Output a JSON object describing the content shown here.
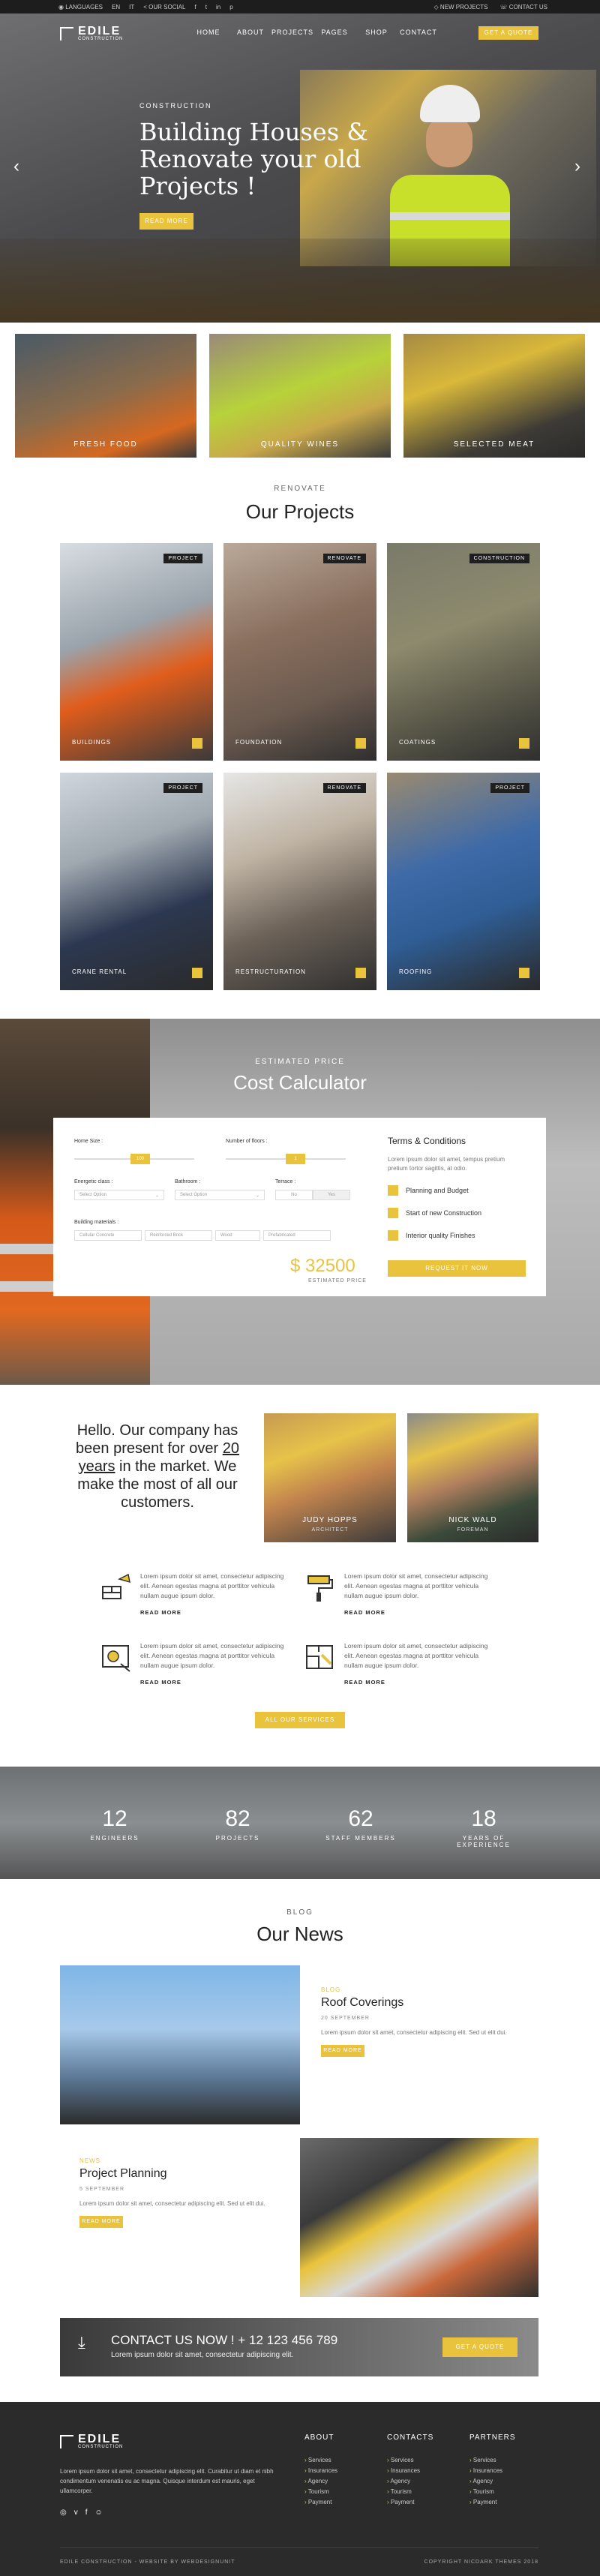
{
  "topbar": {
    "languages": "LANGUAGES",
    "lang_en": "EN",
    "lang_it": "IT",
    "social": "OUR SOCIAL",
    "new_projects": "NEW PROJECTS",
    "contact": "CONTACT US"
  },
  "brand": {
    "name": "EDILE",
    "tagline": "CONSTRUCTION"
  },
  "nav": {
    "items": [
      "HOME",
      "ABOUT",
      "PROJECTS",
      "PAGES",
      "SHOP",
      "CONTACT"
    ],
    "quote": "GET A QUOTE"
  },
  "hero": {
    "eyebrow": "CONSTRUCTION",
    "title": "Building Houses & Renovate your old Projects !",
    "button": "READ MORE"
  },
  "categories": [
    "FRESH FOOD",
    "QUALITY WINES",
    "SELECTED MEAT"
  ],
  "projects_section": {
    "eyebrow": "RENOVATE",
    "title": "Our Projects",
    "items": [
      {
        "tag": "PROJECT",
        "name": "BUILDINGS"
      },
      {
        "tag": "RENOVATE",
        "name": "FOUNDATION"
      },
      {
        "tag": "CONSTRUCTION",
        "name": "COATINGS"
      },
      {
        "tag": "PROJECT",
        "name": "CRANE RENTAL"
      },
      {
        "tag": "RENOVATE",
        "name": "RESTRUCTURATION"
      },
      {
        "tag": "PROJECT",
        "name": "ROOFING"
      }
    ]
  },
  "calculator": {
    "eyebrow": "ESTIMATED PRICE",
    "title": "Cost Calculator",
    "home_size_label": "Home Size :",
    "home_size_value": "100",
    "floors_label": "Number of floors :",
    "floors_value": "1",
    "energy_label": "Energetic class :",
    "energy_value": "Select Option",
    "bathroom_label": "Bathroom :",
    "bathroom_value": "Select Option",
    "terrace_label": "Terrace :",
    "terrace_no": "No",
    "terrace_yes": "Yes",
    "materials_label": "Building materials :",
    "materials": [
      "Cellular Concrete",
      "Reinforced Brick",
      "Wood",
      "Prefabricated"
    ],
    "terms_title": "Terms & Conditions",
    "terms_text": "Lorem ipsum dolor sit amet, tempus pretium pretium tortor sagittis, at odio.",
    "checks": [
      "Planning and Budget",
      "Start of new Construction",
      "Interior quality Finishes"
    ],
    "price": "$ 32500",
    "price_label": "ESTIMATED PRICE",
    "request": "REQUEST IT NOW"
  },
  "about": {
    "pre": "Hello. Our company has been present for over ",
    "years": "20 years",
    "post": " in the market. We make the most of all our customers.",
    "people": [
      {
        "name": "JUDY HOPPS",
        "role": "ARCHITECT"
      },
      {
        "name": "NICK WALD",
        "role": "FOREMAN"
      }
    ],
    "services_text": "Lorem ipsum dolor sit amet, consectetur adipiscing elit. Aenean egestas magna at porttitor vehicula nullam augue ipsum dolor.",
    "read_more": "READ MORE",
    "all_services": "ALL OUR SERVICES"
  },
  "stats": [
    {
      "value": "12",
      "label": "ENGINEERS"
    },
    {
      "value": "82",
      "label": "PROJECTS"
    },
    {
      "value": "62",
      "label": "STAFF MEMBERS"
    },
    {
      "value": "18",
      "label": "YEARS OF EXPERIENCE"
    }
  ],
  "news": {
    "eyebrow": "BLOG",
    "title": "Our News",
    "items": [
      {
        "tag": "BLOG",
        "title": "Roof Coverings",
        "date": "20 SEPTEMBER",
        "text": "Lorem ipsum dolor sit amet, consectetur adipiscing elit. Sed ut elit dui.",
        "button": "READ MORE"
      },
      {
        "tag": "NEWS",
        "title": "Project Planning",
        "date": "5 SEPTEMBER",
        "text": "Lorem ipsum dolor sit amet, consectetur adipiscing elit. Sed ut elit dui.",
        "button": "READ MORE"
      }
    ]
  },
  "cta": {
    "title": "CONTACT US NOW ! + 12 123 456 789",
    "text": "Lorem ipsum dolor sit amet, consectetur adipiscing elit.",
    "button": "GET A QUOTE"
  },
  "footer": {
    "text": "Lorem ipsum dolor sit amet, consectetur adipiscing elit. Curabitur ut diam et nibh condimentum venenatis eu ac magna. Quisque interdum est mauris, eget ullamcorper.",
    "about_title": "ABOUT",
    "contacts_title": "CONTACTS",
    "partners_title": "PARTNERS",
    "links": [
      "Services",
      "Insurances",
      "Agency",
      "Tourism",
      "Payment"
    ],
    "copyright_left": "EDILE CONSTRUCTION - WEBSITE BY WEBDESIGNUNIT",
    "copyright_right": "COPYRIGHT NICDARK THEMES 2018"
  }
}
